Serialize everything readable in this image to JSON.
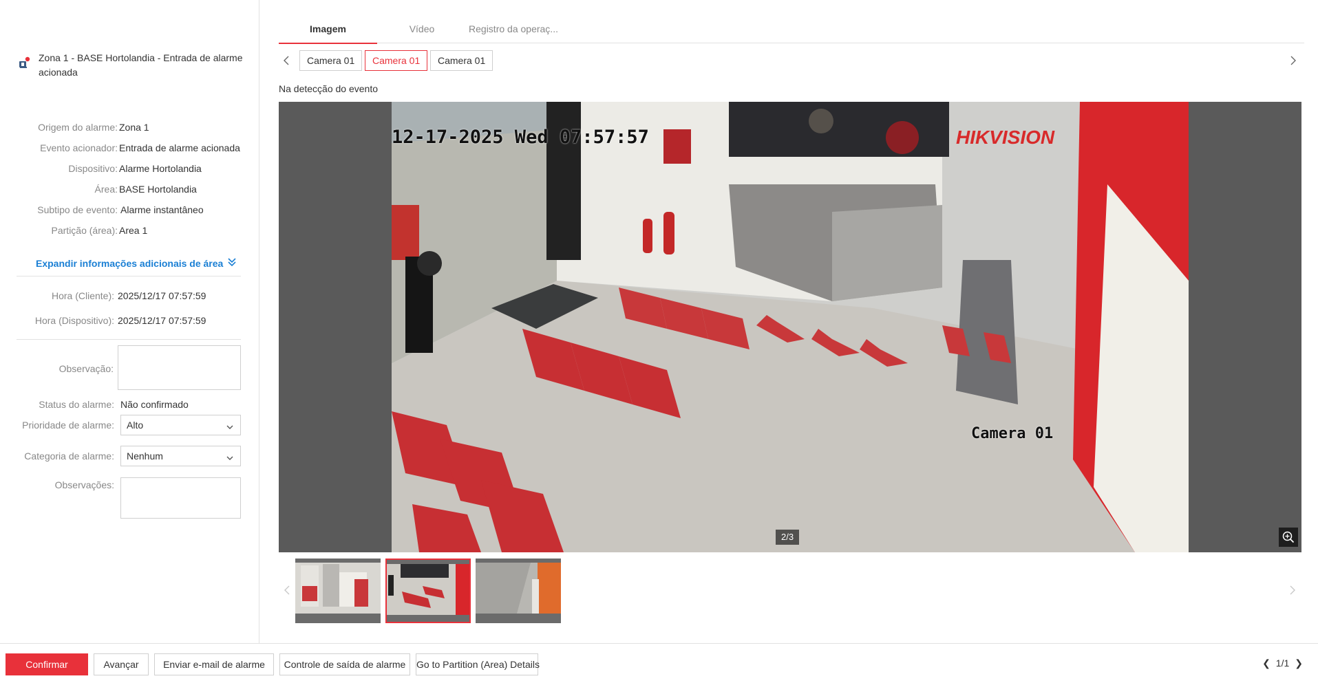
{
  "alarm": {
    "title": "Zona 1 - BASE Hortolandia - Entrada de alarme acionada"
  },
  "details": [
    {
      "label": "Origem do alarme:",
      "value": "Zona 1"
    },
    {
      "label": "Evento acionador:",
      "value": "Entrada de alarme acionada"
    },
    {
      "label": "Dispositivo:",
      "value": "Alarme Hortolandia"
    },
    {
      "label": "Área:",
      "value": "BASE Hortolandia"
    },
    {
      "label": "Subtipo de evento:",
      "value": "Alarme instantâneo"
    },
    {
      "label": "Partição (área):",
      "value": "Area 1"
    }
  ],
  "expand_label": "Expandir informações adicionais de área",
  "times": [
    {
      "label": "Hora (Cliente):",
      "value": "2025/12/17 07:57:59"
    },
    {
      "label": "Hora (Dispositivo):",
      "value": "2025/12/17 07:57:59"
    }
  ],
  "form": {
    "observation_label": "Observação:",
    "observation_value": "",
    "status_label": "Status do alarme:",
    "status_value": "Não confirmado",
    "priority_label": "Prioridade de alarme:",
    "priority_value": "Alto",
    "category_label": "Categoria de alarme:",
    "category_value": "Nenhum",
    "notes_label": "Observações:",
    "notes_value": ""
  },
  "tabs": [
    {
      "label": "Imagem",
      "active": true
    },
    {
      "label": "Vídeo",
      "active": false
    },
    {
      "label": "Registro da operaç...",
      "active": false
    }
  ],
  "cameras": [
    {
      "label": "Camera 01",
      "active": false
    },
    {
      "label": "Camera 01",
      "active": true
    },
    {
      "label": "Camera 01",
      "active": false
    }
  ],
  "viewer": {
    "caption": "Na detecção do evento",
    "osd_time": "12-17-2025 Wed 07:57:57",
    "osd_camera": "Camera 01",
    "osd_brand": "HIKVISION",
    "counter": "2/3",
    "current_image": 2,
    "total_images": 3
  },
  "footer": {
    "buttons": [
      {
        "label": "Confirmar",
        "primary": true
      },
      {
        "label": "Avançar",
        "primary": false
      },
      {
        "label": "Enviar e-mail de alarme",
        "primary": false
      },
      {
        "label": "Controle de saída de alarme",
        "primary": false
      },
      {
        "label": "Go to Partition (Area) Details",
        "primary": false
      }
    ],
    "pager": "1/1"
  },
  "colors": {
    "accent": "#e8313a",
    "link": "#1a7fd4",
    "text": "#333333",
    "muted": "#888888",
    "border": "#e2e2e2"
  }
}
